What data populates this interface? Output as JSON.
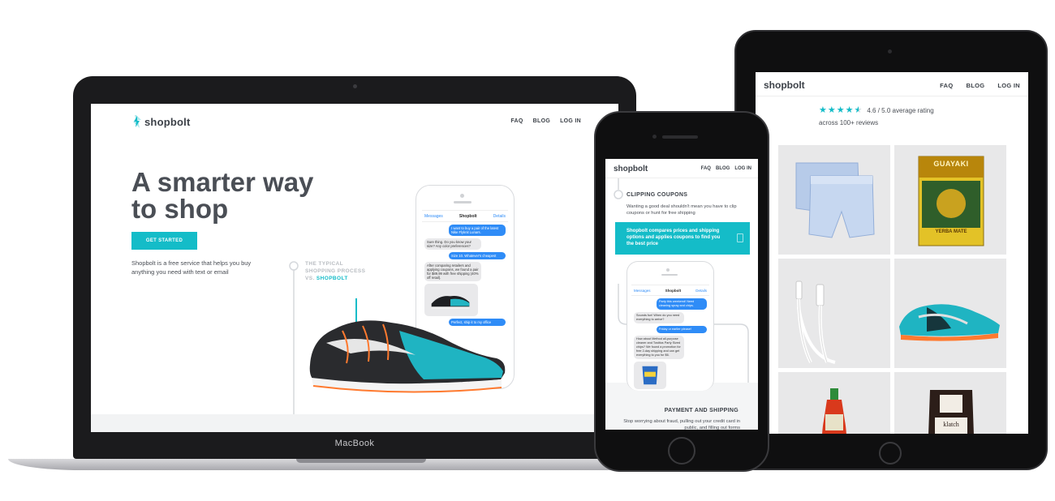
{
  "laptop": {
    "device_label": "MacBook",
    "brand": "shopbolt",
    "nav": [
      "FAQ",
      "BLOG",
      "LOG IN"
    ],
    "headline_line1": "A smarter way",
    "headline_line2": "to shop",
    "cta_label": "GET STARTED",
    "subtext": "Shopbolt is a free service that helps you buy anything you need with text or email",
    "process_line1": "THE TYPICAL",
    "process_line2": "SHOPPING PROCESS",
    "process_vs": "VS.",
    "process_brand": "SHOPBOLT",
    "chat": {
      "back": "Messages",
      "title": "Shopbolt",
      "details": "Details",
      "messages": [
        {
          "dir": "out",
          "text": "I want to buy a pair of the latest Nike Flyknit Lunars."
        },
        {
          "dir": "in",
          "text": "Sure thing. Do you know your size? Any color preferences?"
        },
        {
          "dir": "out",
          "text": "Size 10. Whatever's cheapest"
        },
        {
          "dir": "in",
          "text": "After comparing retailers and applying coupons, we found a pair for $89.99 with free shipping (40% off retail)."
        },
        {
          "dir": "out",
          "text": "Perfect, ship it to my office"
        }
      ]
    }
  },
  "phone": {
    "brand": "shopbolt",
    "nav": [
      "FAQ",
      "BLOG",
      "LOG IN"
    ],
    "section1_title": "CLIPPING COUPONS",
    "section1_text": "Wanting a good deal shouldn't mean you have to clip coupons or hunt for free shipping",
    "band_text": "Shopbolt compares prices and shipping options and applies coupons to find you the best price",
    "chat": {
      "back": "Messages",
      "title": "Shopbolt",
      "details": "Details",
      "messages": [
        {
          "dir": "out",
          "text": "Party this weekend! Need cleaning spray and chips."
        },
        {
          "dir": "in",
          "text": "Sounds fun! When do you need everything to arrive?"
        },
        {
          "dir": "out",
          "text": "Friday or earlier please!"
        },
        {
          "dir": "in",
          "text": "How about Method all-purpose cleaner and Tostitos Party Sized chips? We found a promotion for free 2-day shipping and can get everything to you for $6."
        }
      ]
    },
    "section2_title": "PAYMENT AND SHIPPING",
    "section2_text": "Stop worrying about fraud, pulling out your credit card in public, and filling out forms"
  },
  "tablet": {
    "brand": "shopbolt",
    "nav": [
      "FAQ",
      "BLOG",
      "LOG IN"
    ],
    "rating": 4.6,
    "rating_text": "4.6 / 5.0 average rating",
    "reviews_text": "across 100+ reviews",
    "products": [
      "boxer-shorts",
      "yerba-mate-box",
      "lightning-cable",
      "running-shoes",
      "sriracha-bottle",
      "coffee-bag"
    ],
    "yerba_brand": "GUAYAKI",
    "yerba_sub": "YERBA MATE",
    "coffee_brand": "klatch"
  },
  "colors": {
    "accent": "#14bcc8",
    "text": "#4a4e55",
    "imessage_blue": "#2f8cf7"
  }
}
